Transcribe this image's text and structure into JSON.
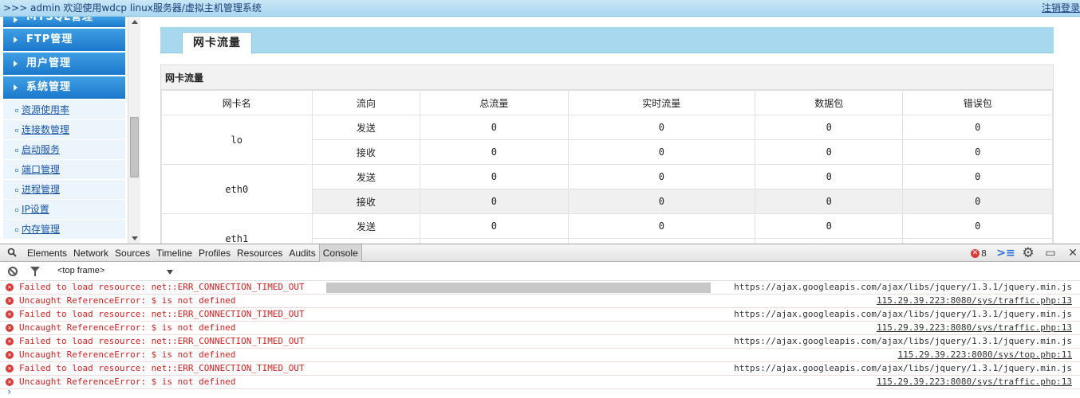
{
  "topbar": {
    "welcome": ">>> admin 欢迎使用wdcp linux服务器/虚拟主机管理系统",
    "logout": "注销登录"
  },
  "sidebar": {
    "sections": [
      {
        "label": "MYSQL管理"
      },
      {
        "label": "FTP管理"
      },
      {
        "label": "用户管理"
      },
      {
        "label": "系统管理"
      }
    ],
    "items": [
      {
        "label": "资源使用率"
      },
      {
        "label": "连接数管理"
      },
      {
        "label": "启动服务"
      },
      {
        "label": "端口管理"
      },
      {
        "label": "进程管理"
      },
      {
        "label": "IP设置"
      },
      {
        "label": "内存管理"
      }
    ]
  },
  "main": {
    "tab_label": "网卡流量",
    "panel_title": "网卡流量",
    "columns": [
      "网卡名",
      "流向",
      "总流量",
      "实时流量",
      "数据包",
      "错误包"
    ],
    "interfaces": [
      {
        "name": "lo",
        "rows": [
          {
            "direction": "发送",
            "total": "0",
            "realtime": "0",
            "packets": "0",
            "errors": "0"
          },
          {
            "direction": "接收",
            "total": "0",
            "realtime": "0",
            "packets": "0",
            "errors": "0"
          }
        ]
      },
      {
        "name": "eth0",
        "rows": [
          {
            "direction": "发送",
            "total": "0",
            "realtime": "0",
            "packets": "0",
            "errors": "0"
          },
          {
            "direction": "接收",
            "total": "0",
            "realtime": "0",
            "packets": "0",
            "errors": "0"
          }
        ]
      },
      {
        "name": "eth1",
        "rows": [
          {
            "direction": "发送",
            "total": "0",
            "realtime": "0",
            "packets": "0",
            "errors": "0"
          }
        ]
      }
    ]
  },
  "devtools": {
    "tabs": [
      "Elements",
      "Network",
      "Sources",
      "Timeline",
      "Profiles",
      "Resources",
      "Audits",
      "Console"
    ],
    "active_tab": "Console",
    "error_count": "8",
    "frame": "<top frame>",
    "messages": [
      {
        "text": "Failed to load resource: net::ERR_CONNECTION_TIMED_OUT",
        "source": "https://ajax.googleapis.com/ajax/libs/jquery/1.3.1/jquery.min.js",
        "link": false,
        "highlight": true
      },
      {
        "text": "Uncaught ReferenceError: $ is not defined",
        "source": "115.29.39.223:8080/sys/traffic.php:13",
        "link": true
      },
      {
        "text": "Failed to load resource: net::ERR_CONNECTION_TIMED_OUT",
        "source": "https://ajax.googleapis.com/ajax/libs/jquery/1.3.1/jquery.min.js",
        "link": false
      },
      {
        "text": "Uncaught ReferenceError: $ is not defined",
        "source": "115.29.39.223:8080/sys/traffic.php:13",
        "link": true
      },
      {
        "text": "Failed to load resource: net::ERR_CONNECTION_TIMED_OUT",
        "source": "https://ajax.googleapis.com/ajax/libs/jquery/1.3.1/jquery.min.js",
        "link": false
      },
      {
        "text": "Uncaught ReferenceError: $ is not defined",
        "source": "115.29.39.223:8080/sys/top.php:11",
        "link": true
      },
      {
        "text": "Failed to load resource: net::ERR_CONNECTION_TIMED_OUT",
        "source": "https://ajax.googleapis.com/ajax/libs/jquery/1.3.1/jquery.min.js",
        "link": false
      },
      {
        "text": "Uncaught ReferenceError: $ is not defined",
        "source": "115.29.39.223:8080/sys/traffic.php:13",
        "link": true
      }
    ],
    "icons": {
      "error": "error-circle-icon",
      "search": "search-icon",
      "settings": "gear-icon",
      "dock": "dock-icon",
      "close": "close-icon",
      "drawer": "console-drawer-icon"
    }
  }
}
